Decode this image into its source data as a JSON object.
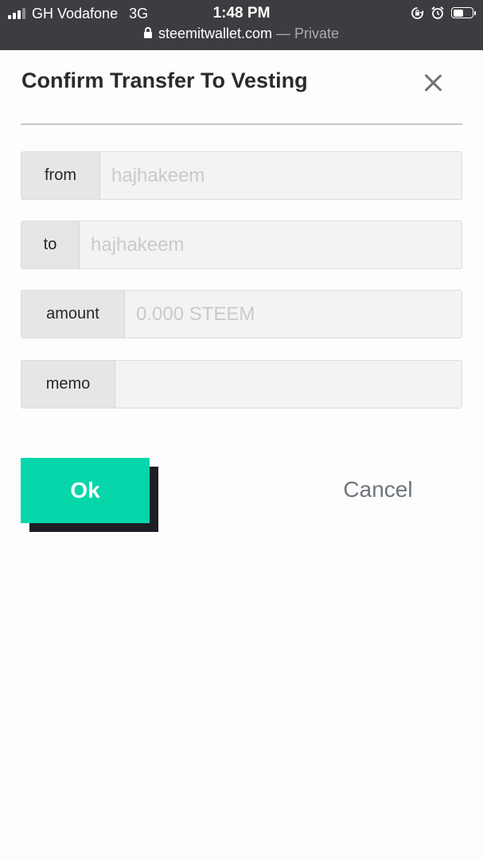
{
  "status_bar": {
    "carrier": "GH Vodafone",
    "network": "3G",
    "time": "1:48 PM",
    "battery_level": 0.55,
    "icons": [
      "signal-icon",
      "orientation-lock-icon",
      "alarm-icon",
      "battery-icon"
    ]
  },
  "browser": {
    "url": "steemitwallet.com",
    "private_label": "— Private"
  },
  "dialog": {
    "title": "Confirm Transfer To Vesting",
    "fields": {
      "from": {
        "label": "from",
        "placeholder": "hajhakeem",
        "value": ""
      },
      "to": {
        "label": "to",
        "placeholder": "hajhakeem",
        "value": ""
      },
      "amount": {
        "label": "amount",
        "placeholder": "0.000 STEEM",
        "value": ""
      },
      "memo": {
        "label": "memo",
        "placeholder": "",
        "value": ""
      }
    },
    "ok_label": "Ok",
    "cancel_label": "Cancel"
  },
  "colors": {
    "accent": "#07d6aa",
    "accent_shadow": "#1b1f24",
    "topbar": "#3b3d40",
    "cancel_text": "#6e757c"
  }
}
